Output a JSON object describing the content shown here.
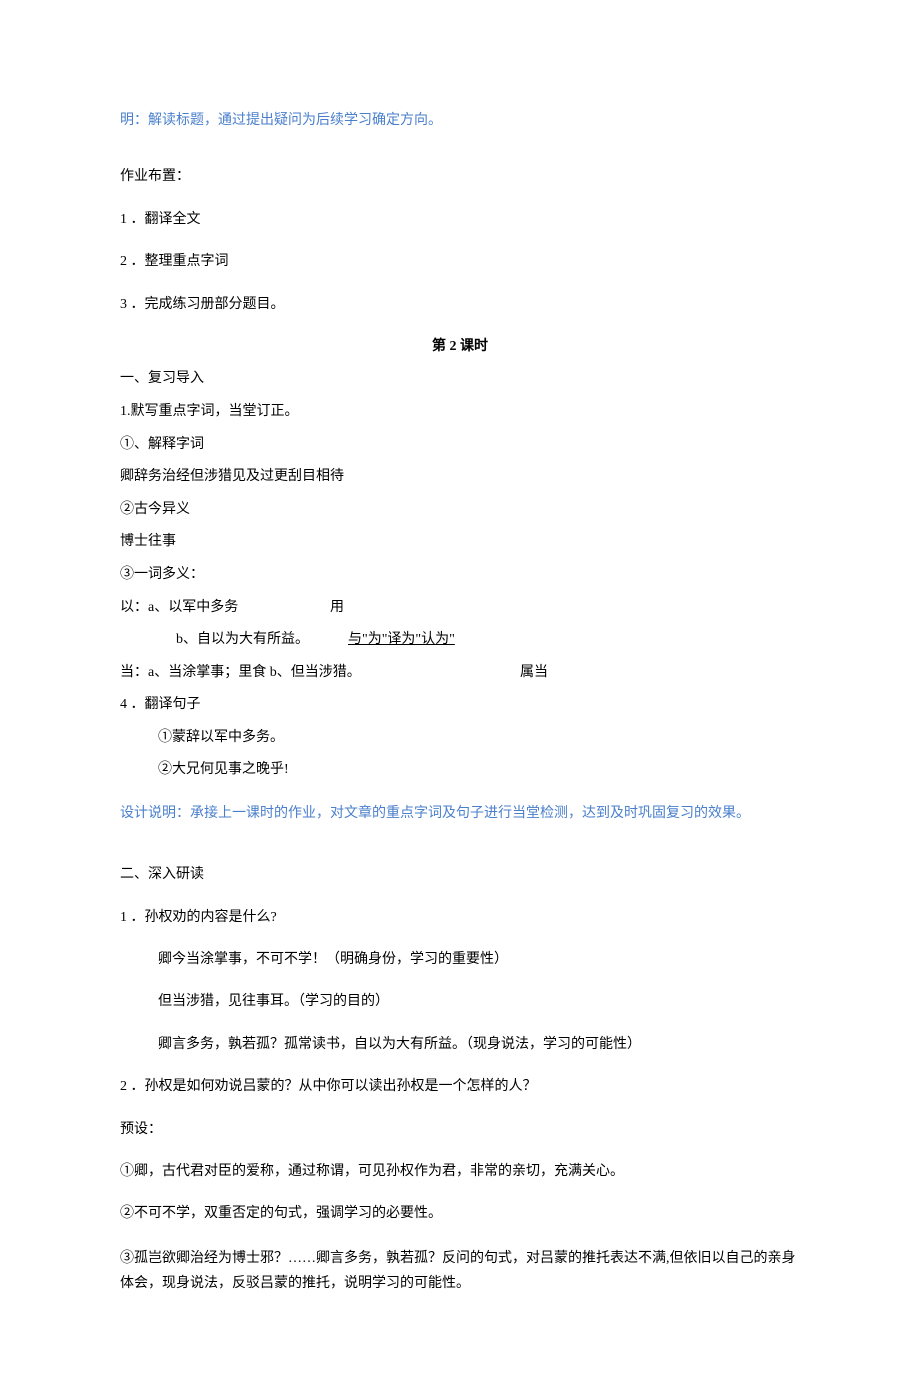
{
  "top_note": "明：解读标题，通过提出疑问为后续学习确定方向。",
  "homework": {
    "heading": "作业布置：",
    "items": [
      "1 ．翻译全文",
      "2 ．整理重点字词",
      "3 ．完成练习册部分题目。"
    ]
  },
  "lesson_title": "第 2 课时",
  "review": {
    "h1": "一、复习导入",
    "l1": "1.默写重点字词，当堂订正。",
    "l2": "①、解释字词",
    "l3": "卿辞务治经但涉猎见及过更刮目相待",
    "l4": "②古今异义",
    "l5": "博士往事",
    "l6": "③一词多义：",
    "yi_a_left": "以：a、以军中多务",
    "yi_a_right": "用",
    "yi_b_left": "b、自以为大有所益。",
    "yi_b_right": "与\"为\"译为\"认为\"",
    "dang_left": "当：a、当涂掌事；里食 b、但当涉猎。",
    "dang_right": "属当",
    "l7": "4 ．翻译句子",
    "l8": "①蒙辞以军中多务。",
    "l9": "②大兄何见事之晚乎!",
    "note": "设计说明：承接上一课时的作业，对文章的重点字词及句子进行当堂检测，达到及时巩固复习的效果。"
  },
  "deep": {
    "h2": "二、深入研读",
    "q1": "1 ．孙权劝的内容是什么?",
    "a1_1": "卿今当涂掌事，不可不学！（明确身份，学习的重要性）",
    "a1_2": "但当涉猎，见往事耳。（学习的目的）",
    "a1_3": "卿言多务，孰若孤？孤常读书，自以为大有所益。（现身说法，学习的可能性）",
    "q2": "2 ．孙权是如何劝说吕蒙的？从中你可以读出孙权是一个怎样的人？",
    "preset": "预设：",
    "p1": "①卿，古代君对臣的爱称，通过称谓，可见孙权作为君，非常的亲切，充满关心。",
    "p2": "②不可不学，双重否定的句式，强调学习的必要性。",
    "p3": "③孤岂欲卿治经为博士邪？……卿言多务，孰若孤？反问的句式，对吕蒙的推托表达不满,但依旧以自己的亲身体会，现身说法，反驳吕蒙的推托，说明学习的可能性。"
  }
}
